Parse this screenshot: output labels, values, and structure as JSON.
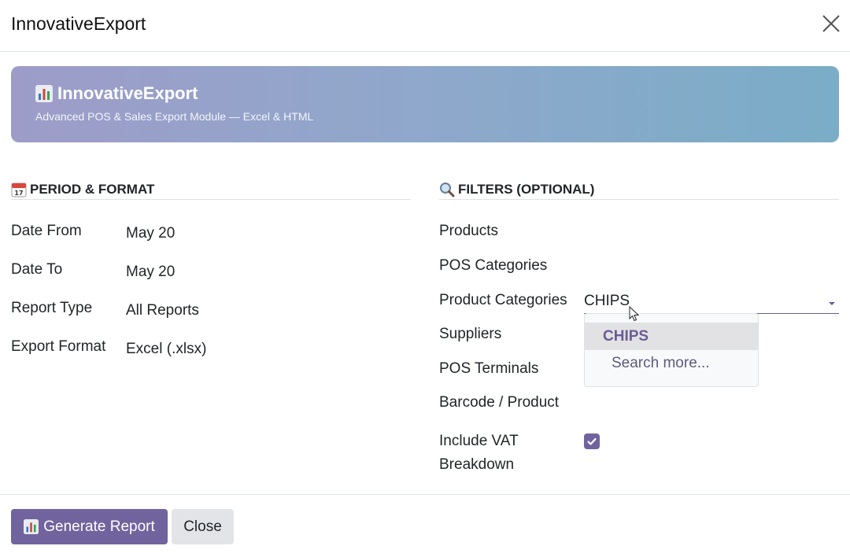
{
  "dialog": {
    "title": "InnovativeExport"
  },
  "banner": {
    "title": "InnovativeExport",
    "subtitle": "Advanced POS & Sales Export Module — Excel & HTML"
  },
  "period_section": {
    "title": "PERIOD & FORMAT",
    "icon": "calendar-icon",
    "fields": [
      {
        "label": "Date From",
        "value": "May 20"
      },
      {
        "label": "Date To",
        "value": "May 20"
      },
      {
        "label": "Report Type",
        "value": "All Reports"
      },
      {
        "label": "Export Format",
        "value": "Excel (.xlsx)"
      }
    ]
  },
  "filters_section": {
    "title": "FILTERS (OPTIONAL)",
    "icon": "magnifier-icon",
    "labels": {
      "products": "Products",
      "pos_categories": "POS Categories",
      "product_categories": "Product Categories",
      "suppliers": "Suppliers",
      "pos_terminals": "POS Terminals",
      "barcode": "Barcode / Product",
      "vat_line1": "Include VAT",
      "vat_line2": "Breakdown"
    },
    "product_categories_value": "CHIPS",
    "dropdown": {
      "highlighted": "CHIPS",
      "search_more": "Search more..."
    },
    "include_vat_checked": true
  },
  "footer": {
    "generate_label": "Generate Report",
    "close_label": "Close"
  },
  "colors": {
    "primary": "#71639e",
    "banner_start": "#9d9cc8",
    "banner_end": "#7aadc7"
  }
}
